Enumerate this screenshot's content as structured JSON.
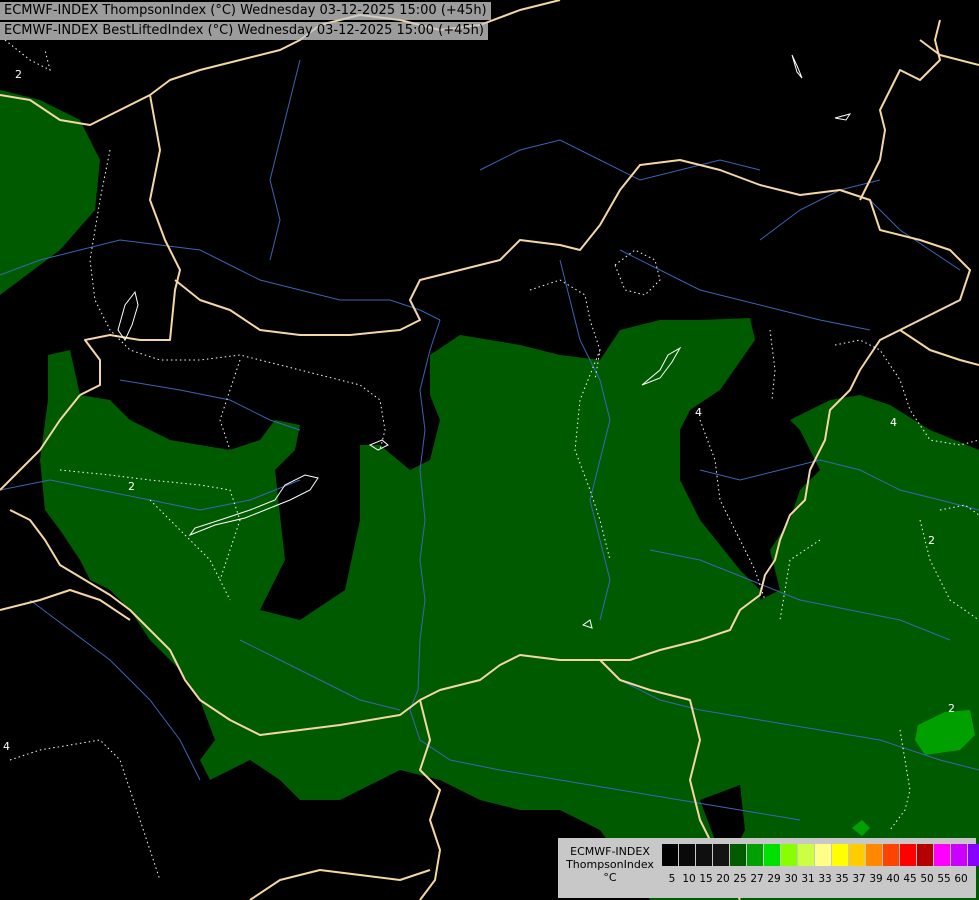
{
  "title_lines": [
    "ECMWF-INDEX ThompsonIndex (°C) Wednesday 03-12-2025 15:00 (+45h)",
    "ECMWF-INDEX BestLiftedIndex (°C) Wednesday 03-12-2025 15:00 (+45h)"
  ],
  "legend": {
    "model": "ECMWF-INDEX",
    "parameter": "ThompsonIndex",
    "unit": "°C",
    "ticks": [
      "5",
      "10",
      "15",
      "20",
      "25",
      "27",
      "29",
      "30",
      "31",
      "33",
      "35",
      "37",
      "39",
      "40",
      "45",
      "50",
      "55",
      "60"
    ],
    "colors": [
      "#000000",
      "#0a0a0a",
      "#0f0f0f",
      "#141414",
      "#005a00",
      "#00a000",
      "#00e000",
      "#88ff00",
      "#ccff44",
      "#ffff88",
      "#ffff00",
      "#ffcc00",
      "#ff8800",
      "#ff4400",
      "#ff0000",
      "#b40000",
      "#ff00ff",
      "#cc00ff",
      "#8800ff",
      "#4400ff",
      "#0000ff"
    ]
  },
  "map": {
    "colors": {
      "background": "#000000",
      "field_20_25": "#005a00",
      "field_25_27": "#00a000",
      "borders": "#f5d7a5",
      "rivers": "#3c64b4",
      "contours": "#ffffff"
    },
    "contour_labels": [
      "2",
      "2",
      "2",
      "2",
      "4",
      "4",
      "4"
    ]
  }
}
